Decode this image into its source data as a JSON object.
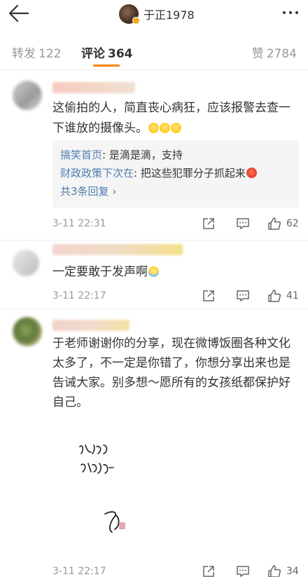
{
  "header": {
    "username": "于正1978"
  },
  "tabs": {
    "repost": {
      "label": "转发",
      "count": "122"
    },
    "comment": {
      "label": "评论",
      "count": "364"
    },
    "like": {
      "label": "赞",
      "count": "2784"
    }
  },
  "comments": [
    {
      "text": "这偷拍的人，简直丧心病狂，应该报警去查一下谁放的摄像头。",
      "replies": [
        {
          "who": "搞笑首页",
          "text": ": 是滴是滴，支持"
        },
        {
          "who": "财政政策下次在",
          "text": ": 把这些犯罪分子抓起来"
        }
      ],
      "more_replies": "共3条回复",
      "time": "3-11 22:31",
      "likes": "62"
    },
    {
      "text": "一定要敢于发声啊",
      "time": "3-11 22:17",
      "likes": "41"
    },
    {
      "text": "于老师谢谢你的分享，现在微博饭圈各种文化太多了，不一定是你错了，你想分享出来也是告诫大家。别多想～愿所有的女孩纸都保护好自己。",
      "time": "3-11 22:17",
      "likes": "34"
    }
  ],
  "colors": {
    "accent": "#ff8200",
    "link": "#4f7cae",
    "muted": "#999999"
  }
}
